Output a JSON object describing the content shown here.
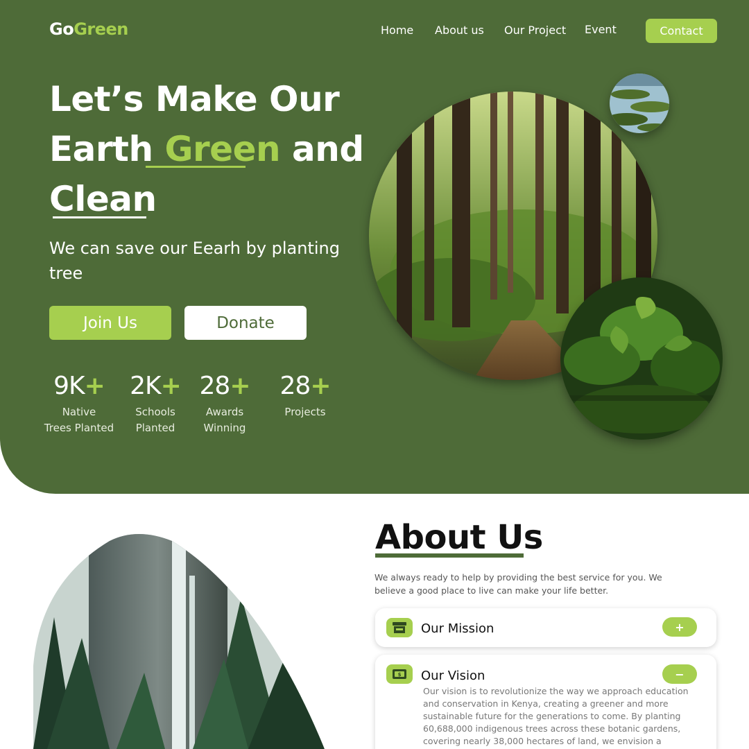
{
  "logo": {
    "part1": "Go",
    "part2": "Green"
  },
  "nav": {
    "items": [
      "Home",
      "About us",
      "Our Project",
      "Event"
    ],
    "contact_label": "Contact"
  },
  "hero": {
    "headline_line1": "Let’s Make Our",
    "headline_line2_a": "Earth ",
    "headline_line2_accent": "Green",
    "headline_line2_b": " and",
    "headline_line3": "Clean",
    "subhead": "We can save our Eearh by planting tree",
    "join_label": "Join Us",
    "donate_label": "Donate",
    "stats": [
      {
        "value": "9K",
        "plus": "+",
        "label": "Native\nTrees Planted"
      },
      {
        "value": "2K",
        "plus": "+",
        "label": "Schools\nPlanted"
      },
      {
        "value": "28",
        "plus": "+",
        "label": "Awards\nWinning"
      },
      {
        "value": "28",
        "plus": "+",
        "label": "Projects"
      }
    ]
  },
  "about": {
    "title": "About Us",
    "description": "We always ready to help by providing the best service for you. We believe a good place to live can make your life better.",
    "mission": {
      "title": "Our Mission",
      "toggle": "+"
    },
    "vision": {
      "title": "Our Vision",
      "toggle": "−",
      "body": "Our vision is to revolutionize the way we approach education and conservation in Kenya, creating a greener and more sustainable future for the generations to come. By planting 60,688,000 indigenous trees across these botanic gardens, covering nearly 38,000 hectares of land, we envision a country that leads in"
    }
  },
  "colors": {
    "primary_green": "#4e6b38",
    "accent_lime": "#a6cf4f",
    "white": "#ffffff"
  }
}
